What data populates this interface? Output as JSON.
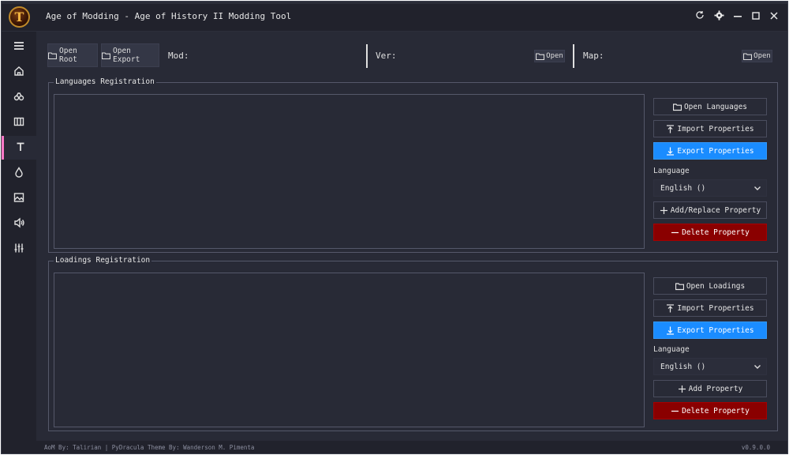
{
  "window": {
    "title": "Age of Modding - Age of History II Modding Tool",
    "logo_letter": "T"
  },
  "toolbar": {
    "open_root": "Open Root",
    "open_export": "Open Export",
    "mod_label": "Mod:",
    "ver_label": "Ver:",
    "ver_open": "Open",
    "map_label": "Map:",
    "map_open": "Open"
  },
  "languages": {
    "title": "Languages Registration",
    "open_button": "Open Languages",
    "import_button": "Import Properties",
    "export_button": "Export Properties",
    "language_label": "Language",
    "language_selected": "English ()",
    "add_button": "Add/Replace Property",
    "delete_button": "Delete Property"
  },
  "loadings": {
    "title": "Loadings Registration",
    "open_button": "Open Loadings",
    "import_button": "Import Properties",
    "export_button": "Export Properties",
    "language_label": "Language",
    "language_selected": "English ()",
    "add_button": "Add Property",
    "delete_button": "Delete Property"
  },
  "sidebar": {
    "items": [
      {
        "icon": "menu-icon"
      },
      {
        "icon": "home-icon"
      },
      {
        "icon": "civilizations-icon"
      },
      {
        "icon": "map-icon"
      },
      {
        "icon": "text-icon"
      },
      {
        "icon": "drop-icon"
      },
      {
        "icon": "image-icon"
      },
      {
        "icon": "sound-icon"
      },
      {
        "icon": "sliders-icon"
      }
    ],
    "active_index": 4
  },
  "footer": {
    "credits": "AoM By: Talirian | PyDracula Theme By: Wanderson M. Pimenta",
    "version": "v0.9.0.0"
  },
  "colors": {
    "background": "#282a36",
    "sidebar": "#21222c",
    "accent_active": "#ff79c6",
    "export_blue": "#1a8cff",
    "delete_red": "#8a0000"
  }
}
